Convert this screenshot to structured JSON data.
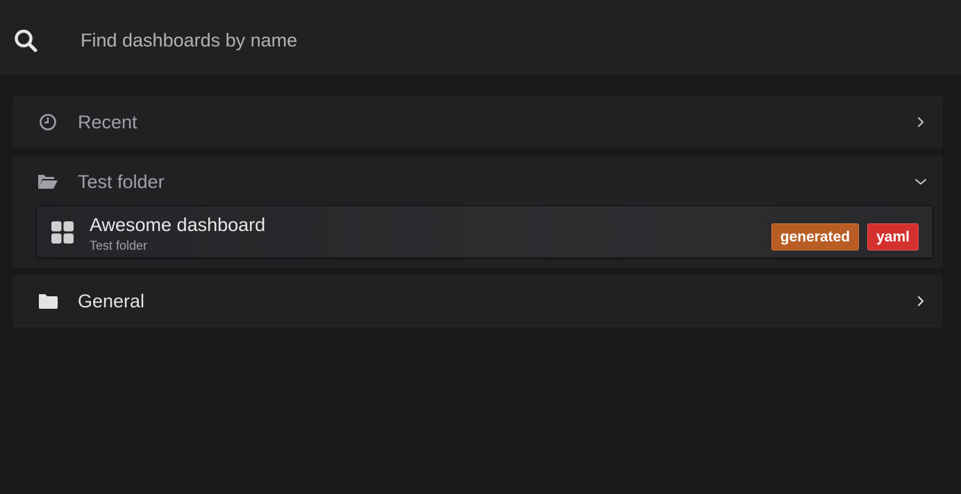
{
  "search": {
    "placeholder": "Find dashboards by name",
    "icon": "search-icon"
  },
  "sections": {
    "recent": {
      "title": "Recent",
      "icon": "clock-icon",
      "expanded": false
    },
    "test_folder": {
      "title": "Test folder",
      "icon": "folder-open-icon",
      "expanded": true,
      "items": [
        {
          "title": "Awesome dashboard",
          "folder": "Test folder",
          "icon": "apps-icon",
          "tags": [
            {
              "label": "generated",
              "color": "#b85d24",
              "border": "#e07a35"
            },
            {
              "label": "yaml",
              "color": "#d4312e",
              "border": "#f05452"
            }
          ]
        }
      ]
    },
    "general": {
      "title": "General",
      "icon": "folder-icon",
      "expanded": false
    }
  },
  "colors": {
    "background": "#18191b",
    "panel": "#212124",
    "text_primary": "#e2e3e4",
    "text_secondary": "#9fa1a6"
  }
}
